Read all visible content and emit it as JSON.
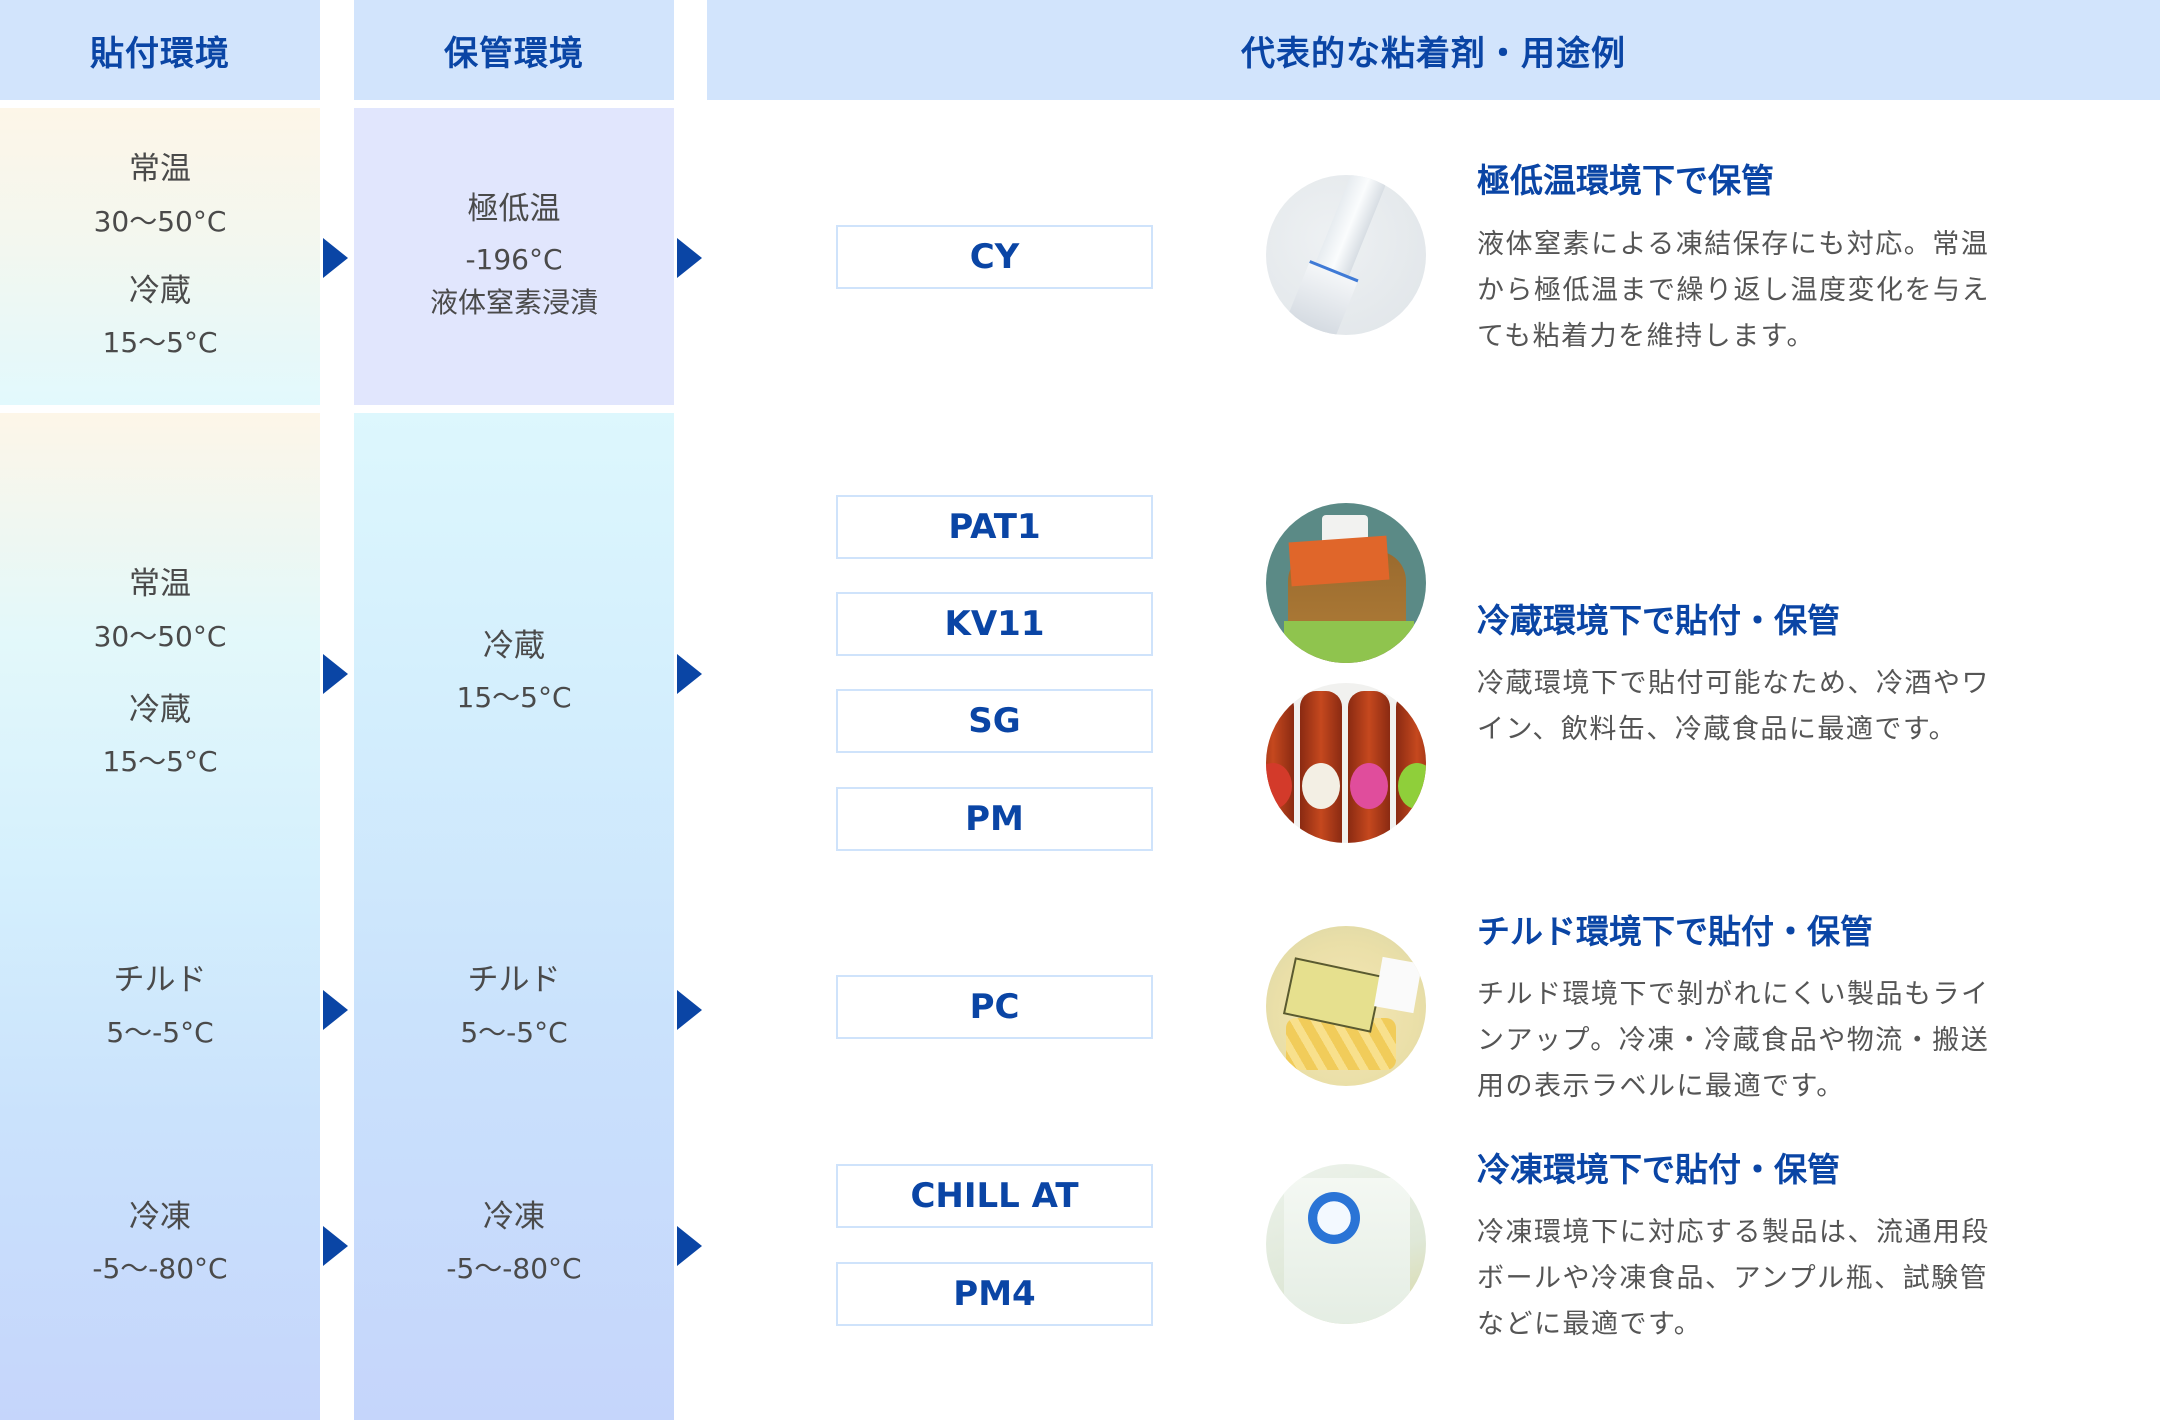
{
  "headers": {
    "apply_env": "貼付環境",
    "storage_env": "保管環境",
    "adhesives_uses": "代表的な粘着剤・用途例"
  },
  "rows": [
    {
      "apply_env": [
        {
          "name": "常温",
          "range": "30〜50°C"
        },
        {
          "name": "冷蔵",
          "range": "15〜5°C"
        }
      ],
      "storage_env": {
        "name": "極低温",
        "range": "-196°C",
        "note": "液体窒素浸漬"
      },
      "adhesives": [
        "CY"
      ],
      "photo": "ampoule-photo",
      "title": "極低温環境下で保管",
      "description_lines": [
        "液体窒素による凍結保存にも対応。常温",
        "から極低温まで繰り返し温度変化を与え",
        "ても粘着力を維持します。"
      ]
    },
    {
      "apply_env": [
        {
          "name": "常温",
          "range": "30〜50°C"
        },
        {
          "name": "冷蔵",
          "range": "15〜5°C"
        }
      ],
      "storage_env": {
        "name": "冷蔵",
        "range": "15〜5°C"
      },
      "adhesives": [
        "PAT1",
        "KV11",
        "SG",
        "PM"
      ],
      "photos": [
        "tea-bottle-photo",
        "beer-bottles-photo"
      ],
      "title": "冷蔵環境下で貼付・保管",
      "description_lines": [
        "冷蔵環境下で貼付可能なため、冷酒やワ",
        "イン、飲料缶、冷蔵食品に最適です。"
      ]
    },
    {
      "apply_env": [
        {
          "name": "チルド",
          "range": "5〜-5°C"
        }
      ],
      "storage_env": {
        "name": "チルド",
        "range": "5〜-5°C"
      },
      "adhesives": [
        "PC"
      ],
      "photo": "chilled-pasta-photo",
      "title": "チルド環境下で貼付・保管",
      "description_lines": [
        "チルド環境下で剝がれにくい製品もライ",
        "ンアップ。冷凍・冷蔵食品や物流・搬送",
        "用の表示ラベルに最適です。"
      ]
    },
    {
      "apply_env": [
        {
          "name": "冷凍",
          "range": "-5〜-80°C"
        }
      ],
      "storage_env": {
        "name": "冷凍",
        "range": "-5〜-80°C"
      },
      "adhesives": [
        "CHILL AT",
        "PM4"
      ],
      "photo": "frozen-box-photo",
      "title": "冷凍環境下で貼付・保管",
      "description_lines": [
        "冷凍環境下に対応する製品は、流通用段",
        "ボールや冷凍食品、アンプル瓶、試験管",
        "などに最適です。"
      ]
    }
  ],
  "colors": {
    "accent": "#0a45a5",
    "header_bg": "#d2e4fc",
    "tag_border": "#cfe3fb",
    "body_text": "#555555"
  }
}
